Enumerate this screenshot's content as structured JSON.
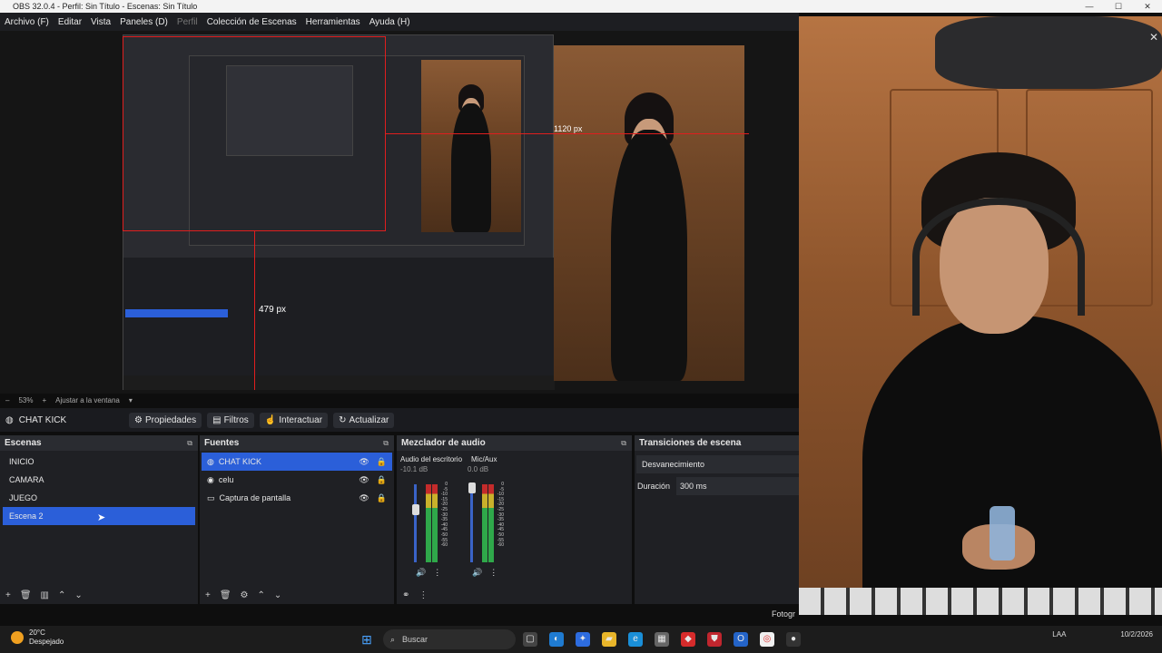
{
  "window": {
    "title": "OBS 32.0.4 - Perfil: Sin Título - Escenas: Sin Título",
    "controls": [
      "—",
      "☐",
      "✕"
    ]
  },
  "menu": [
    {
      "label": "Archivo (F)",
      "dim": false
    },
    {
      "label": "Editar",
      "dim": false
    },
    {
      "label": "Vista",
      "dim": false
    },
    {
      "label": "Paneles (D)",
      "dim": false
    },
    {
      "label": "Perfil",
      "dim": true
    },
    {
      "label": "Colección de Escenas",
      "dim": false
    },
    {
      "label": "Herramientas",
      "dim": false
    },
    {
      "label": "Ayuda (H)",
      "dim": false
    }
  ],
  "preview": {
    "size_label_1": "1120 px",
    "size_label_2": "479 px"
  },
  "zoom": {
    "minus": "–",
    "value": "53%",
    "plus": "+",
    "fit": "Ajustar a la ventana"
  },
  "source_toolbar": {
    "current_source": "CHAT KICK",
    "properties": "Propiedades",
    "filters": "Filtros",
    "interact": "Interactuar",
    "refresh": "Actualizar"
  },
  "scenes": {
    "title": "Escenas",
    "items": [
      {
        "label": "INICIO",
        "selected": false
      },
      {
        "label": "CAMARA",
        "selected": false
      },
      {
        "label": "JUEGO",
        "selected": false
      },
      {
        "label": "Escena 2",
        "selected": true
      }
    ]
  },
  "sources": {
    "title": "Fuentes",
    "items": [
      {
        "label": "CHAT KICK",
        "icon": "globe-icon",
        "selected": true
      },
      {
        "label": "celu",
        "icon": "camera-icon",
        "selected": false
      },
      {
        "label": "Captura de pantalla",
        "icon": "monitor-icon",
        "selected": false
      }
    ]
  },
  "mixer": {
    "title": "Mezclador de audio",
    "channels": [
      {
        "name": "Audio del escritorio",
        "db": "-10.1 dB",
        "volume": 0.45,
        "level": 0.6
      },
      {
        "name": "Mic/Aux",
        "db": "0.0 dB",
        "volume": 0.95,
        "level": 0.7
      }
    ],
    "scale": [
      "0",
      "-5",
      "-10",
      "-15",
      "-20",
      "-25",
      "-30",
      "-35",
      "-40",
      "-45",
      "-50",
      "-55",
      "-60"
    ]
  },
  "transitions": {
    "title": "Transiciones de escena",
    "type": "Desvanecimiento",
    "duration_label": "Duración",
    "duration_value": "300 ms"
  },
  "overlay": {
    "fotograma": "Fotogr"
  },
  "taskbar": {
    "temp": "20°C",
    "weather": "Despejado",
    "search_placeholder": "Buscar",
    "lang": "LAA",
    "date": "10/2/2026"
  }
}
